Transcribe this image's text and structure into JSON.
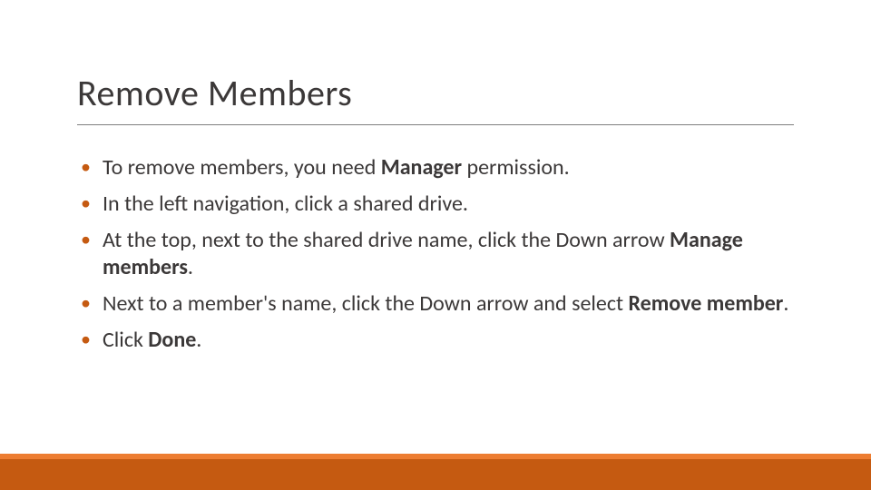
{
  "title": "Remove Members",
  "bullets": [
    {
      "html": "To remove members, you need <b>Manager</b> permission."
    },
    {
      "html": "In the left navigation, click a shared drive."
    },
    {
      "html": "At the top, next to the shared drive name, click the Down arrow <b>Manage members</b>."
    },
    {
      "html": "Next to a member's name, click the Down arrow and select <b>Remove member</b>."
    },
    {
      "html": "Click <b>Done</b>."
    }
  ],
  "theme": {
    "accent": "#c55a11",
    "accent_light": "#ed7d31",
    "text": "#3b3838",
    "rule": "#7f7f7f"
  }
}
